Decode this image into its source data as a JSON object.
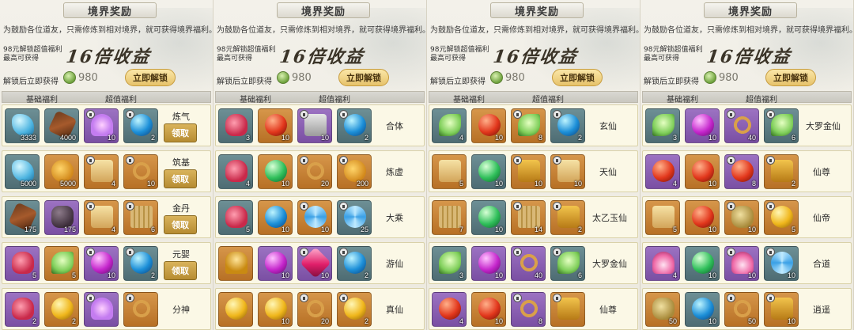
{
  "panels": [
    {
      "title": "境界奖励",
      "intro": "为鼓励各位道友，只需修炼到相对境界，就可获得境界福利。",
      "sub1": "98元解锁超值福利",
      "sub2": "最高可获得",
      "big": "16倍收益",
      "unlock_label": "解锁后立即获得",
      "coin_value": "980",
      "unlock_button": "立即解锁",
      "col_basic": "基础福利",
      "col_value": "超值福利",
      "rows": [
        {
          "realm": "炼气",
          "claim": "领取",
          "items": [
            [
              "blue",
              "s-crystal",
              "3333",
              false
            ],
            [
              "blue",
              "s-branch",
              "4000",
              false
            ],
            [
              "purple",
              "s-wing",
              "10",
              true
            ],
            [
              "blue",
              "s-orb-blue",
              "2",
              true
            ]
          ]
        },
        {
          "realm": "筑基",
          "claim": "领取",
          "items": [
            [
              "blue",
              "s-crystal",
              "5000",
              false
            ],
            [
              "orange",
              "s-gourd",
              "5000",
              false
            ],
            [
              "orange",
              "s-scroll",
              "4",
              true
            ],
            [
              "orange",
              "s-rope",
              "10",
              true
            ]
          ]
        },
        {
          "realm": "金丹",
          "claim": "领取",
          "items": [
            [
              "blue",
              "s-branch",
              "175",
              false
            ],
            [
              "purple",
              "s-rock",
              "175",
              false
            ],
            [
              "orange",
              "s-scroll",
              "4",
              true
            ],
            [
              "orange",
              "s-bamboo",
              "6",
              true
            ]
          ]
        },
        {
          "realm": "元婴",
          "claim": "领取",
          "items": [
            [
              "purple",
              "s-pouch",
              "5",
              false
            ],
            [
              "orange",
              "s-leaf",
              "5",
              false
            ],
            [
              "purple",
              "s-orb-purple",
              "10",
              true
            ],
            [
              "blue",
              "s-orb-blue",
              "2",
              true
            ]
          ]
        },
        {
          "realm": "分神",
          "claim": "",
          "items": [
            [
              "purple",
              "s-pouch",
              "2",
              false
            ],
            [
              "orange",
              "s-orb-gold",
              "2",
              false
            ],
            [
              "purple",
              "s-wing",
              "",
              true
            ],
            [
              "orange",
              "s-rope",
              "",
              true
            ]
          ]
        }
      ]
    },
    {
      "title": "境界奖励",
      "intro": "为鼓励各位道友，只需修炼到相对境界，就可获得境界福利。",
      "sub1": "98元解锁超值福利",
      "sub2": "最高可获得",
      "big": "16倍收益",
      "unlock_label": "解锁后立即获得",
      "coin_value": "980",
      "unlock_button": "立即解锁",
      "col_basic": "基础福利",
      "col_value": "超值福利",
      "rows": [
        {
          "realm": "合体",
          "claim": "",
          "items": [
            [
              "blue",
              "s-pouch",
              "3",
              false
            ],
            [
              "orange",
              "s-orb-red",
              "10",
              false
            ],
            [
              "purple",
              "s-box",
              "10",
              true
            ],
            [
              "blue",
              "s-orb-blue",
              "2",
              true
            ]
          ]
        },
        {
          "realm": "炼虚",
          "claim": "",
          "items": [
            [
              "blue",
              "s-pouch",
              "4",
              false
            ],
            [
              "orange",
              "s-orb-green",
              "10",
              false
            ],
            [
              "orange",
              "s-rope",
              "20",
              true
            ],
            [
              "orange",
              "s-gourd",
              "200",
              true
            ]
          ]
        },
        {
          "realm": "大乘",
          "claim": "",
          "items": [
            [
              "blue",
              "s-pouch",
              "5",
              false
            ],
            [
              "orange",
              "s-orb-blue",
              "10",
              false
            ],
            [
              "orange",
              "s-swirl",
              "10",
              true
            ],
            [
              "blue",
              "s-swirl",
              "25",
              true
            ]
          ]
        },
        {
          "realm": "游仙",
          "claim": "",
          "items": [
            [
              "orange",
              "s-bell",
              "",
              false
            ],
            [
              "purple",
              "s-orb-purple",
              "10",
              false
            ],
            [
              "purple",
              "s-gem",
              "10",
              true
            ],
            [
              "blue",
              "s-orb-blue",
              "2",
              true
            ]
          ]
        },
        {
          "realm": "真仙",
          "claim": "",
          "items": [
            [
              "orange",
              "s-orb-gold",
              "",
              false
            ],
            [
              "orange",
              "s-orb-gold",
              "10",
              false
            ],
            [
              "orange",
              "s-rope",
              "20",
              true
            ],
            [
              "orange",
              "s-orb-gold",
              "2",
              true
            ]
          ]
        }
      ]
    },
    {
      "title": "境界奖励",
      "intro": "为鼓励各位道友，只需修炼到相对境界，就可获得境界福利。",
      "sub1": "98元解锁超值福利",
      "sub2": "最高可获得",
      "big": "16倍收益",
      "unlock_label": "解锁后立即获得",
      "coin_value": "980",
      "unlock_button": "立即解锁",
      "col_basic": "基础福利",
      "col_value": "超值福利",
      "rows": [
        {
          "realm": "玄仙",
          "claim": "",
          "items": [
            [
              "blue",
              "s-leaf",
              "4",
              false
            ],
            [
              "orange",
              "s-orb-red",
              "10",
              false
            ],
            [
              "orange",
              "s-leaf",
              "8",
              true
            ],
            [
              "blue",
              "s-orb-blue",
              "2",
              true
            ]
          ]
        },
        {
          "realm": "天仙",
          "claim": "",
          "items": [
            [
              "orange",
              "s-scroll",
              "5",
              false
            ],
            [
              "blue",
              "s-orb-green",
              "10",
              false
            ],
            [
              "orange",
              "s-chest",
              "10",
              true
            ],
            [
              "orange",
              "s-scroll",
              "10",
              true
            ]
          ]
        },
        {
          "realm": "太乙玉仙",
          "claim": "",
          "items": [
            [
              "orange",
              "s-bamboo",
              "7",
              false
            ],
            [
              "blue",
              "s-orb-green",
              "10",
              false
            ],
            [
              "orange",
              "s-bamboo",
              "14",
              true
            ],
            [
              "orange",
              "s-chest",
              "2",
              true
            ]
          ]
        },
        {
          "realm": "大罗金仙",
          "claim": "",
          "items": [
            [
              "blue",
              "s-leaf",
              "3",
              false
            ],
            [
              "purple",
              "s-orb-purple",
              "10",
              false
            ],
            [
              "purple",
              "s-rope",
              "40",
              true
            ],
            [
              "blue",
              "s-leaf",
              "6",
              true
            ]
          ]
        },
        {
          "realm": "仙尊",
          "claim": "",
          "items": [
            [
              "purple",
              "s-orb-red",
              "4",
              false
            ],
            [
              "orange",
              "s-orb-red",
              "10",
              false
            ],
            [
              "purple",
              "s-rope",
              "8",
              true
            ],
            [
              "orange",
              "s-chest",
              "",
              true
            ]
          ]
        }
      ]
    },
    {
      "title": "境界奖励",
      "intro": "为鼓励各位道友，只需修炼到相对境界，就可获得境界福利。",
      "sub1": "98元解锁超值福利",
      "sub2": "最高可获得",
      "big": "16倍收益",
      "unlock_label": "解锁后立即获得",
      "coin_value": "980",
      "unlock_button": "立即解锁",
      "col_basic": "基础福利",
      "col_value": "超值福利",
      "rows": [
        {
          "realm": "大罗金仙",
          "claim": "",
          "items": [
            [
              "blue",
              "s-leaf",
              "3",
              false
            ],
            [
              "purple",
              "s-orb-purple",
              "10",
              false
            ],
            [
              "purple",
              "s-rope",
              "40",
              true
            ],
            [
              "blue",
              "s-leaf",
              "6",
              true
            ]
          ]
        },
        {
          "realm": "仙尊",
          "claim": "",
          "items": [
            [
              "purple",
              "s-orb-red",
              "4",
              false
            ],
            [
              "orange",
              "s-orb-red",
              "10",
              false
            ],
            [
              "purple",
              "s-orb-red",
              "8",
              true
            ],
            [
              "orange",
              "s-chest",
              "2",
              true
            ]
          ]
        },
        {
          "realm": "仙帝",
          "claim": "",
          "items": [
            [
              "orange",
              "s-scroll",
              "5",
              false
            ],
            [
              "orange",
              "s-orb-red",
              "10",
              false
            ],
            [
              "orange",
              "s-frog",
              "10",
              true
            ],
            [
              "orange",
              "s-orb-gold",
              "5",
              true
            ]
          ]
        },
        {
          "realm": "合道",
          "claim": "",
          "items": [
            [
              "purple",
              "s-lotus",
              "4",
              false
            ],
            [
              "blue",
              "s-orb-green",
              "10",
              false
            ],
            [
              "purple",
              "s-lotus",
              "10",
              true
            ],
            [
              "blue",
              "s-swirl",
              "10",
              true
            ]
          ]
        },
        {
          "realm": "逍遥",
          "claim": "",
          "items": [
            [
              "orange",
              "s-frog",
              "50",
              false
            ],
            [
              "blue",
              "s-orb-blue",
              "10",
              false
            ],
            [
              "orange",
              "s-rope",
              "50",
              true
            ],
            [
              "orange",
              "s-chest",
              "10",
              true
            ]
          ]
        }
      ]
    }
  ]
}
